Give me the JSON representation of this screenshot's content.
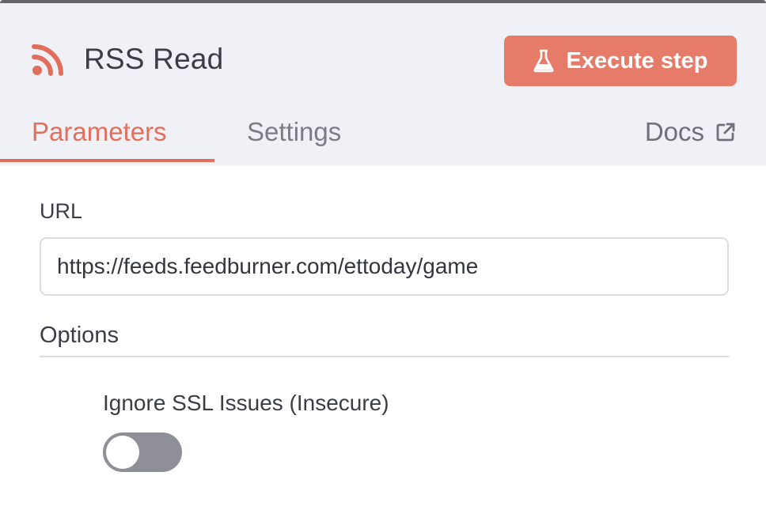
{
  "node": {
    "title": "RSS Read",
    "icon": "rss-icon",
    "accent_color": "#e57b68"
  },
  "actions": {
    "execute_label": "Execute step",
    "execute_icon": "flask-icon"
  },
  "tabs": [
    {
      "label": "Parameters",
      "active": true
    },
    {
      "label": "Settings",
      "active": false
    }
  ],
  "docs": {
    "label": "Docs",
    "icon": "external-link-icon"
  },
  "fields": {
    "url": {
      "label": "URL",
      "value": "https://feeds.feedburner.com/ettoday/game"
    }
  },
  "options": {
    "heading": "Options",
    "ignore_ssl": {
      "label": "Ignore SSL Issues (Insecure)",
      "enabled": false
    }
  }
}
